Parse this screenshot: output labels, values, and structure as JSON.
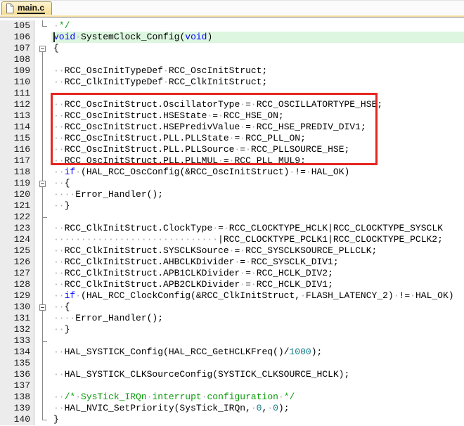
{
  "tab_bar": {
    "tab_label": "main.c"
  },
  "editor": {
    "colors": {
      "keyword": "#0000ff",
      "comment": "#089a08",
      "number": "#0f7b8a",
      "plain": "#000000",
      "whitespace": "#ababab",
      "line_highlight": "#ddf6df",
      "gutter_bg": "#ececec",
      "red_box": "#e52620",
      "tab_strip": "#f2dc9e",
      "fold": "#888888"
    },
    "first_line_number": 105,
    "last_line_number": 140,
    "lines": [
      {
        "n": 105,
        "f": "corner",
        "hl": false,
        "s": [
          [
            "w",
            " "
          ],
          [
            "c",
            "*/"
          ]
        ]
      },
      {
        "n": 106,
        "f": "",
        "hl": true,
        "s": [
          [
            "k",
            "void"
          ],
          [
            "w",
            " "
          ],
          [
            "p",
            "SystemClock_Config("
          ],
          [
            "k",
            "void"
          ],
          [
            "p",
            ")"
          ]
        ]
      },
      {
        "n": 107,
        "f": "boxstart",
        "hl": false,
        "s": [
          [
            "p",
            "{"
          ]
        ]
      },
      {
        "n": 108,
        "f": "line",
        "hl": false,
        "s": []
      },
      {
        "n": 109,
        "f": "line",
        "hl": false,
        "s": [
          [
            "w",
            "  "
          ],
          [
            "p",
            "RCC_OscInitTypeDef"
          ],
          [
            "w",
            " "
          ],
          [
            "p",
            "RCC_OscInitStruct;"
          ]
        ]
      },
      {
        "n": 110,
        "f": "line",
        "hl": false,
        "s": [
          [
            "w",
            "  "
          ],
          [
            "p",
            "RCC_ClkInitTypeDef"
          ],
          [
            "w",
            " "
          ],
          [
            "p",
            "RCC_ClkInitStruct;"
          ]
        ]
      },
      {
        "n": 111,
        "f": "line",
        "hl": false,
        "s": []
      },
      {
        "n": 112,
        "f": "line",
        "hl": false,
        "s": [
          [
            "w",
            "  "
          ],
          [
            "p",
            "RCC_OscInitStruct.OscillatorType"
          ],
          [
            "w",
            " "
          ],
          [
            "p",
            "="
          ],
          [
            "w",
            " "
          ],
          [
            "p",
            "RCC_OSCILLATORTYPE_HSE;"
          ]
        ]
      },
      {
        "n": 113,
        "f": "line",
        "hl": false,
        "s": [
          [
            "w",
            "  "
          ],
          [
            "p",
            "RCC_OscInitStruct.HSEState"
          ],
          [
            "w",
            " "
          ],
          [
            "p",
            "="
          ],
          [
            "w",
            " "
          ],
          [
            "p",
            "RCC_HSE_ON;"
          ]
        ]
      },
      {
        "n": 114,
        "f": "line",
        "hl": false,
        "s": [
          [
            "w",
            "  "
          ],
          [
            "p",
            "RCC_OscInitStruct.HSEPredivValue"
          ],
          [
            "w",
            " "
          ],
          [
            "p",
            "="
          ],
          [
            "w",
            " "
          ],
          [
            "p",
            "RCC_HSE_PREDIV_DIV1;"
          ]
        ]
      },
      {
        "n": 115,
        "f": "line",
        "hl": false,
        "s": [
          [
            "w",
            "  "
          ],
          [
            "p",
            "RCC_OscInitStruct.PLL.PLLState"
          ],
          [
            "w",
            " "
          ],
          [
            "p",
            "="
          ],
          [
            "w",
            " "
          ],
          [
            "p",
            "RCC_PLL_ON;"
          ]
        ]
      },
      {
        "n": 116,
        "f": "line",
        "hl": false,
        "s": [
          [
            "w",
            "  "
          ],
          [
            "p",
            "RCC_OscInitStruct.PLL.PLLSource"
          ],
          [
            "w",
            " "
          ],
          [
            "p",
            "="
          ],
          [
            "w",
            " "
          ],
          [
            "p",
            "RCC_PLLSOURCE_HSE;"
          ]
        ]
      },
      {
        "n": 117,
        "f": "line",
        "hl": false,
        "s": [
          [
            "w",
            "  "
          ],
          [
            "p",
            "RCC_OscInitStruct.PLL.PLLMUL"
          ],
          [
            "w",
            " "
          ],
          [
            "p",
            "="
          ],
          [
            "w",
            " "
          ],
          [
            "p",
            "RCC_PLL_MUL9;"
          ]
        ]
      },
      {
        "n": 118,
        "f": "line",
        "hl": false,
        "s": [
          [
            "w",
            "  "
          ],
          [
            "k",
            "if"
          ],
          [
            "w",
            " "
          ],
          [
            "p",
            "(HAL_RCC_OscConfig(&RCC_OscInitStruct)"
          ],
          [
            "w",
            " "
          ],
          [
            "p",
            "!="
          ],
          [
            "w",
            " "
          ],
          [
            "p",
            "HAL_OK)"
          ]
        ]
      },
      {
        "n": 119,
        "f": "box",
        "hl": false,
        "s": [
          [
            "w",
            "  "
          ],
          [
            "p",
            "{"
          ]
        ]
      },
      {
        "n": 120,
        "f": "line",
        "hl": false,
        "s": [
          [
            "w",
            "    "
          ],
          [
            "p",
            "Error_Handler();"
          ]
        ]
      },
      {
        "n": 121,
        "f": "line",
        "hl": false,
        "s": [
          [
            "w",
            "  "
          ],
          [
            "p",
            "}"
          ]
        ]
      },
      {
        "n": 122,
        "f": "tick",
        "hl": false,
        "s": []
      },
      {
        "n": 123,
        "f": "line",
        "hl": false,
        "s": [
          [
            "w",
            "  "
          ],
          [
            "p",
            "RCC_ClkInitStruct.ClockType"
          ],
          [
            "w",
            " "
          ],
          [
            "p",
            "="
          ],
          [
            "w",
            " "
          ],
          [
            "p",
            "RCC_CLOCKTYPE_HCLK|RCC_CLOCKTYPE_SYSCLK"
          ]
        ]
      },
      {
        "n": 124,
        "f": "line",
        "hl": false,
        "s": [
          [
            "w",
            "                              "
          ],
          [
            "p",
            "|RCC_CLOCKTYPE_PCLK1|RCC_CLOCKTYPE_PCLK2;"
          ]
        ]
      },
      {
        "n": 125,
        "f": "line",
        "hl": false,
        "s": [
          [
            "w",
            "  "
          ],
          [
            "p",
            "RCC_ClkInitStruct.SYSCLKSource"
          ],
          [
            "w",
            " "
          ],
          [
            "p",
            "="
          ],
          [
            "w",
            " "
          ],
          [
            "p",
            "RCC_SYSCLKSOURCE_PLLCLK;"
          ]
        ]
      },
      {
        "n": 126,
        "f": "line",
        "hl": false,
        "s": [
          [
            "w",
            "  "
          ],
          [
            "p",
            "RCC_ClkInitStruct.AHBCLKDivider"
          ],
          [
            "w",
            " "
          ],
          [
            "p",
            "="
          ],
          [
            "w",
            " "
          ],
          [
            "p",
            "RCC_SYSCLK_DIV1;"
          ]
        ]
      },
      {
        "n": 127,
        "f": "line",
        "hl": false,
        "s": [
          [
            "w",
            "  "
          ],
          [
            "p",
            "RCC_ClkInitStruct.APB1CLKDivider"
          ],
          [
            "w",
            " "
          ],
          [
            "p",
            "="
          ],
          [
            "w",
            " "
          ],
          [
            "p",
            "RCC_HCLK_DIV2;"
          ]
        ]
      },
      {
        "n": 128,
        "f": "line",
        "hl": false,
        "s": [
          [
            "w",
            "  "
          ],
          [
            "p",
            "RCC_ClkInitStruct.APB2CLKDivider"
          ],
          [
            "w",
            " "
          ],
          [
            "p",
            "="
          ],
          [
            "w",
            " "
          ],
          [
            "p",
            "RCC_HCLK_DIV1;"
          ]
        ]
      },
      {
        "n": 129,
        "f": "line",
        "hl": false,
        "s": [
          [
            "w",
            "  "
          ],
          [
            "k",
            "if"
          ],
          [
            "w",
            " "
          ],
          [
            "p",
            "(HAL_RCC_ClockConfig(&RCC_ClkInitStruct,"
          ],
          [
            "w",
            " "
          ],
          [
            "p",
            "FLASH_LATENCY_2)"
          ],
          [
            "w",
            " "
          ],
          [
            "p",
            "!="
          ],
          [
            "w",
            " "
          ],
          [
            "p",
            "HAL_OK)"
          ]
        ]
      },
      {
        "n": 130,
        "f": "box",
        "hl": false,
        "s": [
          [
            "w",
            "  "
          ],
          [
            "p",
            "{"
          ]
        ]
      },
      {
        "n": 131,
        "f": "line",
        "hl": false,
        "s": [
          [
            "w",
            "    "
          ],
          [
            "p",
            "Error_Handler();"
          ]
        ]
      },
      {
        "n": 132,
        "f": "line",
        "hl": false,
        "s": [
          [
            "w",
            "  "
          ],
          [
            "p",
            "}"
          ]
        ]
      },
      {
        "n": 133,
        "f": "tick",
        "hl": false,
        "s": []
      },
      {
        "n": 134,
        "f": "line",
        "hl": false,
        "s": [
          [
            "w",
            "  "
          ],
          [
            "p",
            "HAL_SYSTICK_Config(HAL_RCC_GetHCLKFreq()/"
          ],
          [
            "n",
            "1000"
          ],
          [
            "p",
            ");"
          ]
        ]
      },
      {
        "n": 135,
        "f": "line",
        "hl": false,
        "s": []
      },
      {
        "n": 136,
        "f": "line",
        "hl": false,
        "s": [
          [
            "w",
            "  "
          ],
          [
            "p",
            "HAL_SYSTICK_CLKSourceConfig(SYSTICK_CLKSOURCE_HCLK);"
          ]
        ]
      },
      {
        "n": 137,
        "f": "line",
        "hl": false,
        "s": []
      },
      {
        "n": 138,
        "f": "line",
        "hl": false,
        "s": [
          [
            "w",
            "  "
          ],
          [
            "c",
            "/*"
          ],
          [
            "w",
            " "
          ],
          [
            "c",
            "SysTick_IRQn"
          ],
          [
            "w",
            " "
          ],
          [
            "c",
            "interrupt"
          ],
          [
            "w",
            " "
          ],
          [
            "c",
            "configuration"
          ],
          [
            "w",
            " "
          ],
          [
            "c",
            "*/"
          ]
        ]
      },
      {
        "n": 139,
        "f": "line",
        "hl": false,
        "s": [
          [
            "w",
            "  "
          ],
          [
            "p",
            "HAL_NVIC_SetPriority(SysTick_IRQn,"
          ],
          [
            "w",
            " "
          ],
          [
            "n",
            "0"
          ],
          [
            "p",
            ","
          ],
          [
            "w",
            " "
          ],
          [
            "n",
            "0"
          ],
          [
            "p",
            ");"
          ]
        ]
      },
      {
        "n": 140,
        "f": "corner",
        "hl": false,
        "s": [
          [
            "p",
            "}"
          ]
        ]
      }
    ]
  }
}
